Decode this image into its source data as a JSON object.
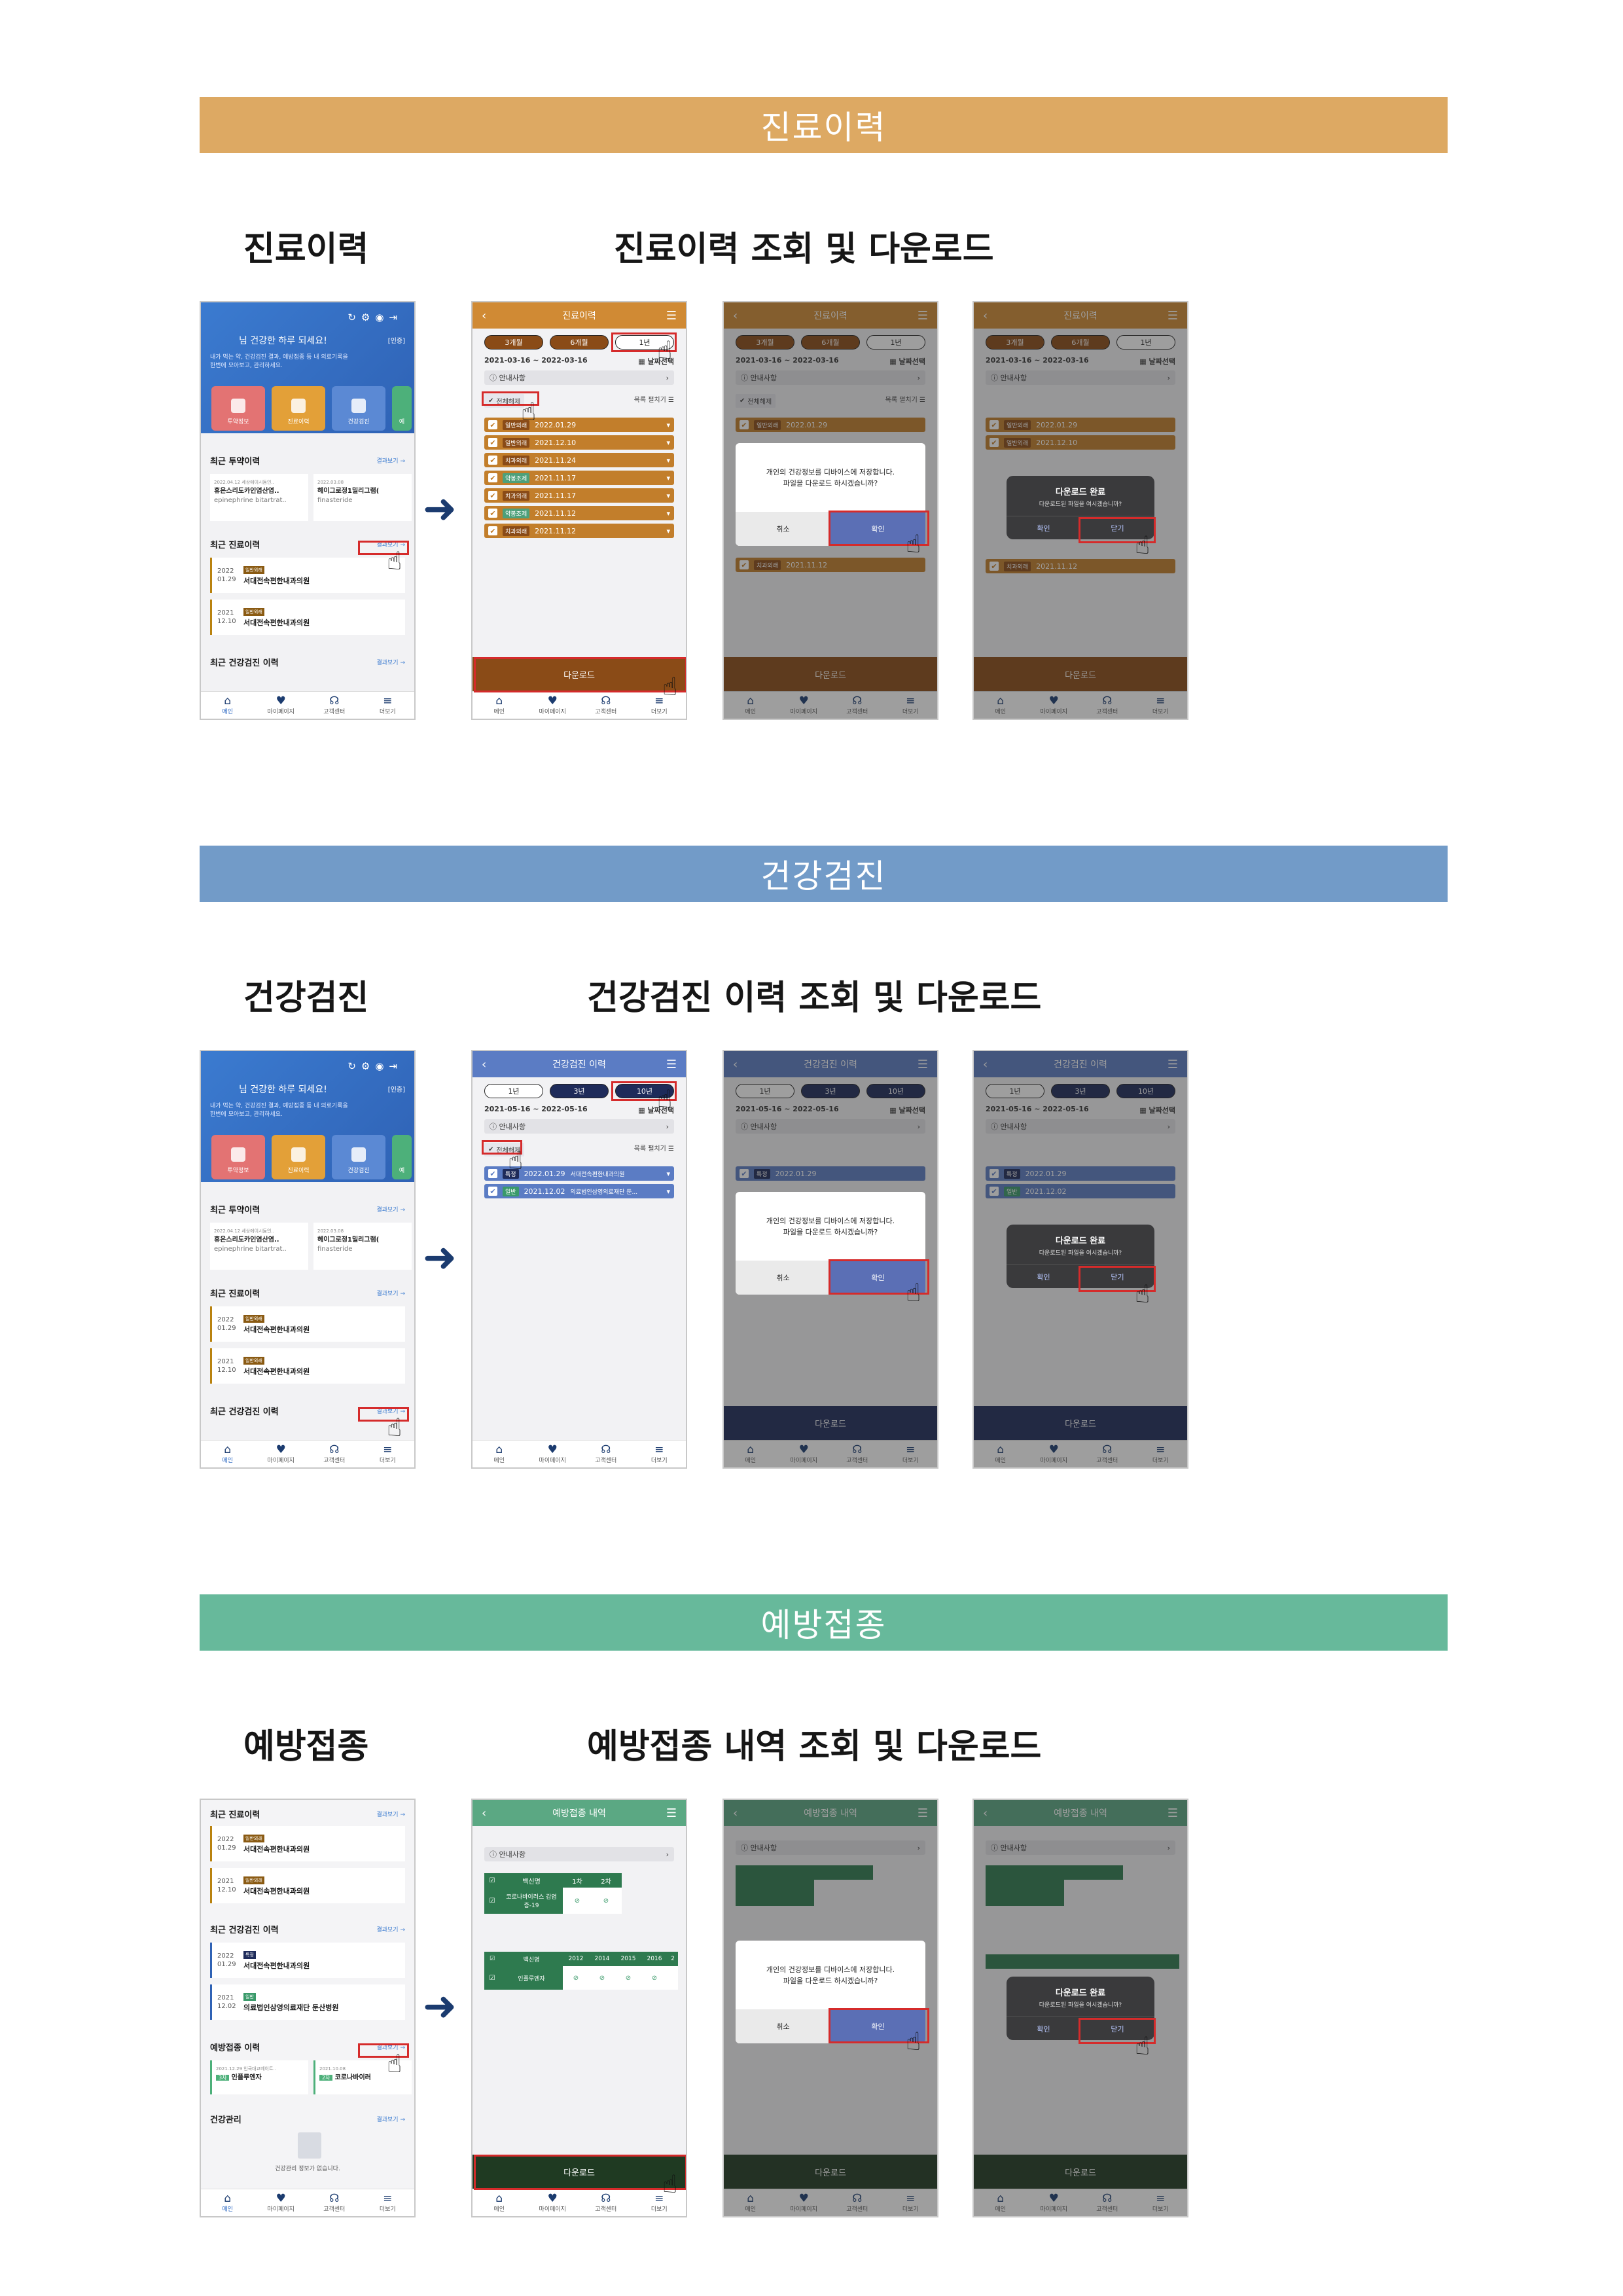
{
  "sections": [
    {
      "banner": "진료이력",
      "left_title": "진료이력",
      "right_title": "진료이력 조회 및 다운로드",
      "color": "#DDA963"
    },
    {
      "banner": "건강검진",
      "left_title": "건강검진",
      "right_title": "건강검진 이력 조회 및 다운로드",
      "color": "#729BC8"
    },
    {
      "banner": "예방접종",
      "left_title": "예방접종",
      "right_title": "예방접종 내역 조회 및 다운로드",
      "color": "#67B99B"
    }
  ],
  "home": {
    "greeting": "님 건강한 하루 되세요!",
    "auth": "[인증]",
    "subtext": "내가 먹는 약, 건강검진 결과, 예방접종 등 내 의료기록을 한번에 모아보고, 관리하세요.",
    "cards": [
      "투약정보",
      "진료이력",
      "건강검진",
      "예"
    ],
    "recent_drug": "최근 투약이력",
    "more": "결과보기",
    "drugs": [
      {
        "date": "2022.04.12  세상에이시듐인..",
        "name": "휴온스리도카인염산염..",
        "sub": "epinephrine bitartrat.."
      },
      {
        "date": "2022.03.08",
        "name": "헤이그로정1밀리그램(",
        "sub": "finasteride"
      }
    ],
    "recent_care": "최근 진료이력",
    "care": [
      {
        "y": "2022",
        "d": "01.29",
        "tag": "일반외래",
        "name": "서대전속편한내과의원"
      },
      {
        "y": "2021",
        "d": "12.10",
        "tag": "일반외래",
        "name": "서대전속편한내과의원"
      }
    ],
    "recent_checkup": "최근 건강검진 이력",
    "checkups": [
      {
        "y": "2022",
        "d": "01.29",
        "tag": "특정",
        "name": "서대전속편한내과의원"
      },
      {
        "y": "2021",
        "d": "12.02",
        "tag": "일반",
        "name": "의료법인삼영의료재단 둔산병원"
      }
    ],
    "vaccine_title": "예방접종 이력",
    "vaccines": [
      {
        "date": "2021.12.29 인국대교베이트..",
        "tag": "3차",
        "name": "인플루엔자"
      },
      {
        "date": "2021.10.08",
        "tag": "2차",
        "name": "코로나바이러"
      }
    ],
    "health_mgmt": "건강관리",
    "health_empty": "건강관리 정보가 없습니다.",
    "nav": [
      "메인",
      "마이페이지",
      "고객센터",
      "더보기"
    ]
  },
  "care_screen": {
    "title": "진료이력",
    "pills": [
      "3개월",
      "6개월",
      "1년"
    ],
    "range": "2021-03-16 ~ 2022-03-16",
    "datepick": "날짜선택",
    "notice": "안내사항",
    "select_all": "전체해제",
    "view_list": "목록 펼치기",
    "rows": [
      {
        "tag": "일반외래",
        "date": "2022.01.29"
      },
      {
        "tag": "일반외래",
        "date": "2021.12.10"
      },
      {
        "tag": "치과외래",
        "date": "2021.11.24"
      },
      {
        "tag": "약봉조제",
        "date": "2021.11.17"
      },
      {
        "tag": "치과외래",
        "date": "2021.11.17"
      },
      {
        "tag": "약봉조제",
        "date": "2021.11.12"
      },
      {
        "tag": "치과외래",
        "date": "2021.11.12"
      }
    ],
    "download": "다운로드"
  },
  "checkup_screen": {
    "title": "건강검진 이력",
    "pills": [
      "1년",
      "3년",
      "10년"
    ],
    "range": "2021-05-16 ~ 2022-05-16",
    "rows": [
      {
        "tag": "특정",
        "date": "2022.01.29",
        "name": "서대전속편한내과의원"
      },
      {
        "tag": "일반",
        "date": "2021.12.02",
        "name": "의료법인삼영의료재단 둔..."
      }
    ]
  },
  "vaccine_screen": {
    "title": "예방접종 내역",
    "head1": [
      "백신명",
      "1차",
      "2차"
    ],
    "vac1": "코로나바이러스 감염증-19",
    "head2": [
      "백신명",
      "2012",
      "2014",
      "2015",
      "2016",
      "2"
    ],
    "vac2": "인플루엔자"
  },
  "dialog": {
    "msg1": "개인의 건강정보를 디바이스에 저장합니다.",
    "msg2": "파일을 다운로드 하시겠습니까?",
    "cancel": "취소",
    "ok": "확인"
  },
  "done": {
    "title": "다운로드 완료",
    "msg": "다운로드된 파일을 여시겠습니까?",
    "ok": "확인",
    "close": "닫기"
  },
  "colors": {
    "care": "#C27E2B",
    "care_dark": "#8A4B17",
    "checkup": "#5B7CC4",
    "checkup_dark": "#1E2B5A",
    "vaccine": "#5BA883",
    "vaccine_dark": "#1F3A22",
    "navy": "#1B3B6F"
  }
}
